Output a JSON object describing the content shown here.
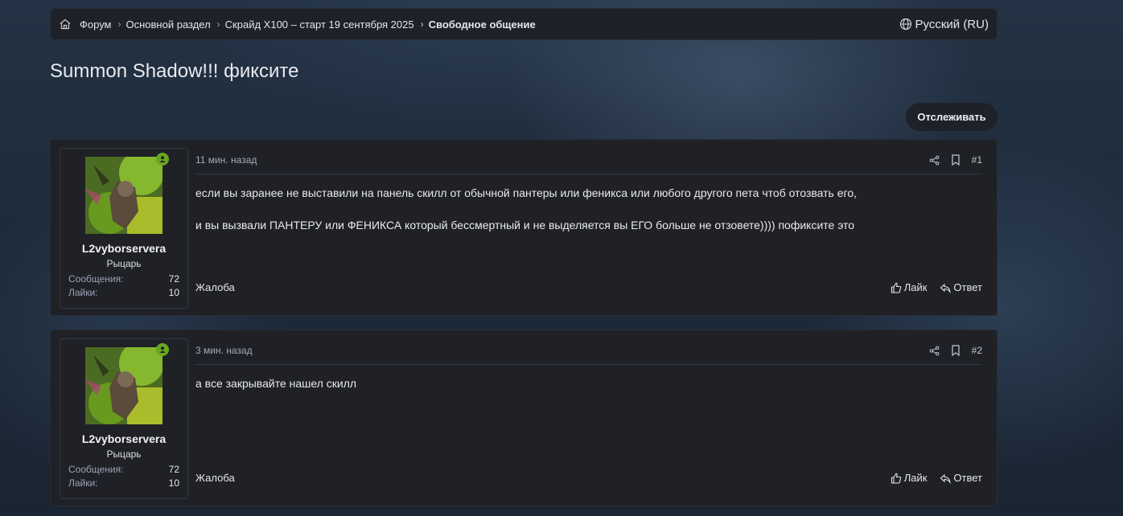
{
  "breadcrumbs": [
    {
      "label": "Форум"
    },
    {
      "label": "Основной раздел"
    },
    {
      "label": "Скрайд X100 – старт 19 сентября 2025"
    },
    {
      "label": "Свободное общение"
    }
  ],
  "language": "Русский (RU)",
  "thread": {
    "title": "Summon Shadow!!! фиксите",
    "watch_label": "Отслеживать"
  },
  "labels": {
    "messages": "Сообщения:",
    "likes": "Лайки:",
    "report": "Жалоба",
    "like": "Лайк",
    "reply": "Ответ"
  },
  "posts": [
    {
      "author": "L2vyborservera",
      "user_title": "Рыцарь",
      "messages_count": "72",
      "likes_count": "10",
      "time": "11 мин. назад",
      "number": "#1",
      "paragraphs": [
        "если вы заранее не выставили на панель скилл от обычной пантеры или феникса или любого другого пета чтоб отозвать его,",
        "и вы вызвали ПАНТЕРУ или ФЕНИКСА который бессмертный и не выделяется вы ЕГО больше не отзовете)))) пофиксите это"
      ]
    },
    {
      "author": "L2vyborservera",
      "user_title": "Рыцарь",
      "messages_count": "72",
      "likes_count": "10",
      "time": "3 мин. назад",
      "number": "#2",
      "paragraphs": [
        "а все закрывайте нашел скилл"
      ]
    }
  ],
  "colors": {
    "online": "#6aa720",
    "panel": "#1f2127"
  }
}
